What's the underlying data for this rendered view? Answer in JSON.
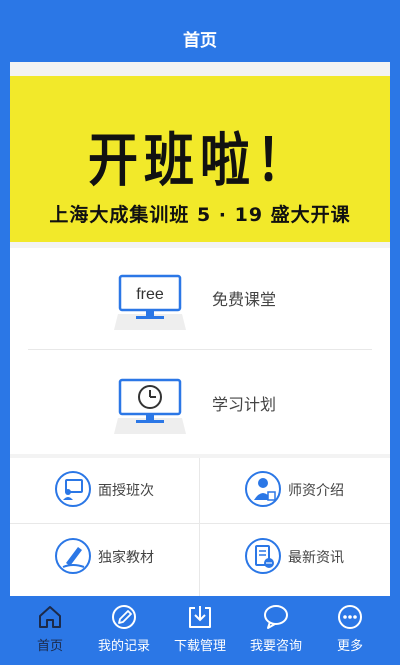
{
  "header": {
    "title": "首页"
  },
  "banner": {
    "title": "开班啦！",
    "subtitle": "上海大成集训班 5 · 19 盛大开课"
  },
  "features": [
    {
      "label": "免费课堂",
      "icon": "free-monitor-icon",
      "icon_text": "free"
    },
    {
      "label": "学习计划",
      "icon": "clock-monitor-icon"
    }
  ],
  "grid": [
    {
      "label": "面授班次",
      "icon": "teacher-board-icon"
    },
    {
      "label": "师资介绍",
      "icon": "person-icon"
    },
    {
      "label": "独家教材",
      "icon": "pen-icon"
    },
    {
      "label": "最新资讯",
      "icon": "news-icon"
    }
  ],
  "tabs": [
    {
      "label": "首页",
      "icon": "home-icon",
      "active": true
    },
    {
      "label": "我的记录",
      "icon": "pencil-icon",
      "active": false
    },
    {
      "label": "下载管理",
      "icon": "download-icon",
      "active": false
    },
    {
      "label": "我要咨询",
      "icon": "chat-icon",
      "active": false
    },
    {
      "label": "更多",
      "icon": "more-icon",
      "active": false
    }
  ],
  "colors": {
    "primary": "#2b77e6",
    "banner_bg": "#f2e92a",
    "icon_blue": "#2b77e6",
    "active_tab": "#1c2a4a"
  }
}
